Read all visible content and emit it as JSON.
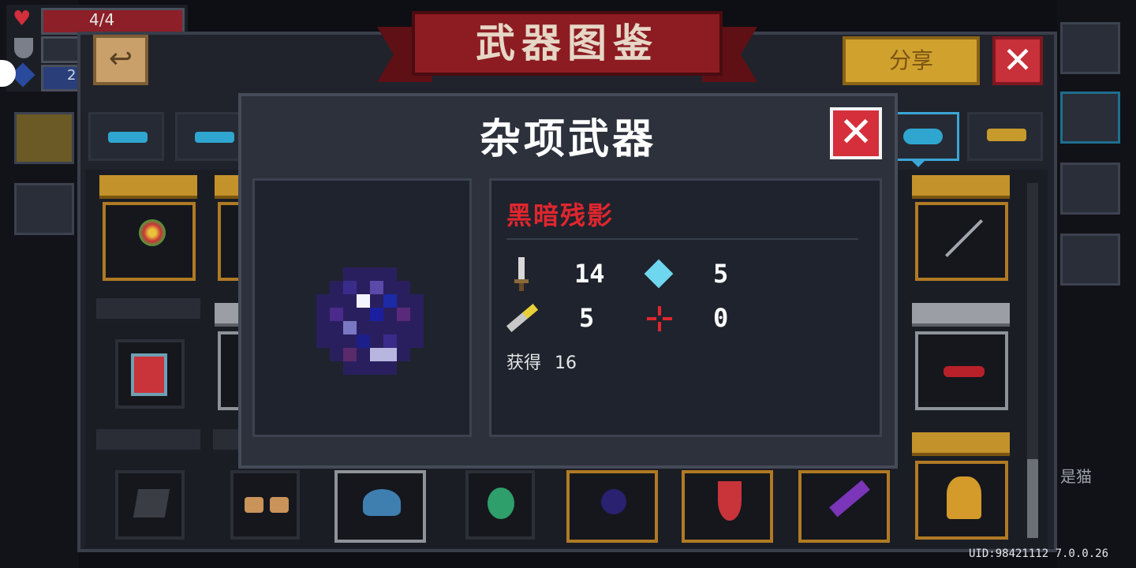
{
  "hud": {
    "hp": "4/4",
    "armor_value": "2"
  },
  "header": {
    "title": "武器图鉴",
    "share_label": "分享",
    "close_label": "✕",
    "back_label": "↩"
  },
  "tabs": [
    {
      "name": "pistol",
      "color": "#2fa6d0"
    },
    {
      "name": "rifle",
      "color": "#2fa6d0"
    },
    {
      "name": "fish",
      "color": "#2fa6d0",
      "active": true
    },
    {
      "name": "crown",
      "color": "#c79a2c"
    }
  ],
  "modal": {
    "title": "杂项武器",
    "close_label": "✕",
    "weapon_name": "黑暗残影",
    "stats": {
      "damage": "14",
      "energy": "5",
      "crit": "5",
      "accuracy": "0"
    },
    "obtain_label": "获得",
    "obtain_count": "16"
  },
  "background_text": {
    "side_name": "是猫"
  },
  "footer": {
    "uid": "UID:98421112 7.0.0.26"
  },
  "colors": {
    "weapon_name": "#e0262e",
    "gold_frame": "#b07a24",
    "accent_blue": "#3aa6d6"
  }
}
